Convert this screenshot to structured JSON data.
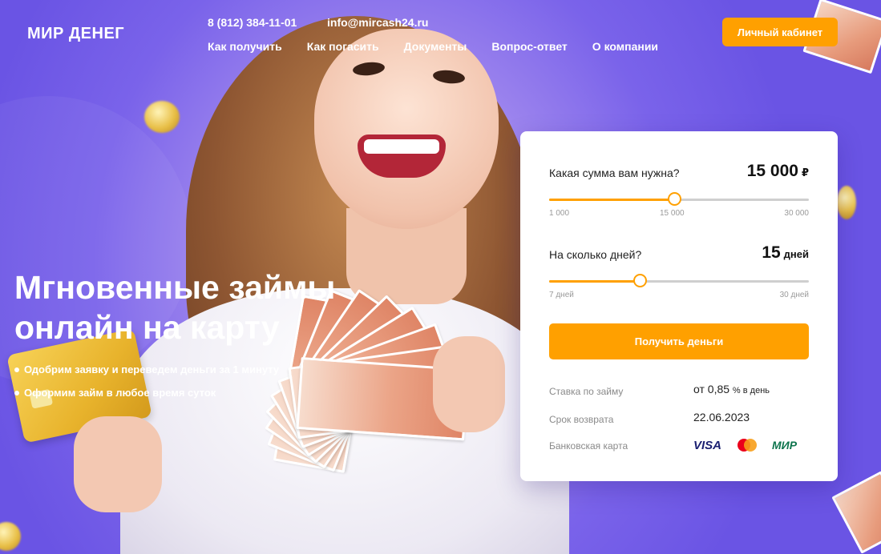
{
  "header": {
    "logo": "МИР ДЕНЕГ",
    "phone": "8 (812) 384-11-01",
    "email": "info@mircash24.ru",
    "nav": [
      "Как получить",
      "Как погасить",
      "Документы",
      "Вопрос-ответ",
      "О компании"
    ],
    "cabinet_button": "Личный кабинет"
  },
  "hero": {
    "title_line1": "Мгновенные займы",
    "title_line2": "онлайн на карту",
    "bullets": [
      "Одобрим заявку и переведем деньги за 1 минуту",
      "Оформим займ в любое время суток"
    ]
  },
  "calculator": {
    "amount": {
      "question": "Какая сумма вам нужна?",
      "value": "15 000",
      "unit": "₽",
      "fraction": 0.48,
      "ticks": [
        "1 000",
        "15 000",
        "30 000"
      ]
    },
    "days": {
      "question": "На сколько дней?",
      "value": "15",
      "unit": "дней",
      "fraction": 0.35,
      "ticks": [
        "7 дней",
        "30 дней"
      ]
    },
    "submit_button": "Получить деньги",
    "rate_label": "Ставка по займу",
    "rate_value": "от 0,85",
    "rate_suffix": "% в день",
    "return_label": "Срок возврата",
    "return_value": "22.06.2023",
    "card_label": "Банковская карта",
    "payment_systems": [
      "VISA",
      "mastercard-icon",
      "МИР"
    ]
  },
  "colors": {
    "accent": "#ffa000",
    "background": "#6a57e6",
    "visa": "#1a1f71",
    "mir": "#0f754e"
  }
}
